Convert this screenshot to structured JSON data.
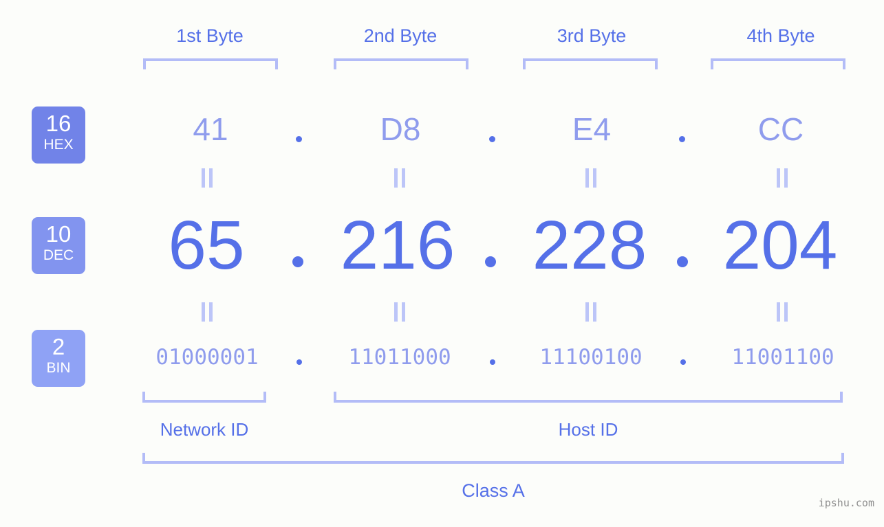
{
  "background_color": "#fcfdfa",
  "accent_color": "#5570e8",
  "accent_light_color": "#8f9ced",
  "bracket_color": "#b3bcf7",
  "byte_headers": [
    {
      "label": "1st Byte"
    },
    {
      "label": "2nd Byte"
    },
    {
      "label": "3rd Byte"
    },
    {
      "label": "4th Byte"
    }
  ],
  "rows": {
    "hex": {
      "badge_number": "16",
      "badge_name": "HEX",
      "values": [
        "41",
        "D8",
        "E4",
        "CC"
      ],
      "separator": "."
    },
    "dec": {
      "badge_number": "10",
      "badge_name": "DEC",
      "values": [
        "65",
        "216",
        "228",
        "204"
      ],
      "separator": "."
    },
    "bin": {
      "badge_number": "2",
      "badge_name": "BIN",
      "values": [
        "01000001",
        "11011000",
        "11100100",
        "11001100"
      ],
      "separator": "."
    }
  },
  "equality_marks": {
    "symbol": "=",
    "count_row1": 4,
    "count_row2": 4
  },
  "id_sections": [
    {
      "label": "Network ID"
    },
    {
      "label": "Host ID"
    }
  ],
  "class_label": "Class A",
  "watermark": "ipshu.com"
}
